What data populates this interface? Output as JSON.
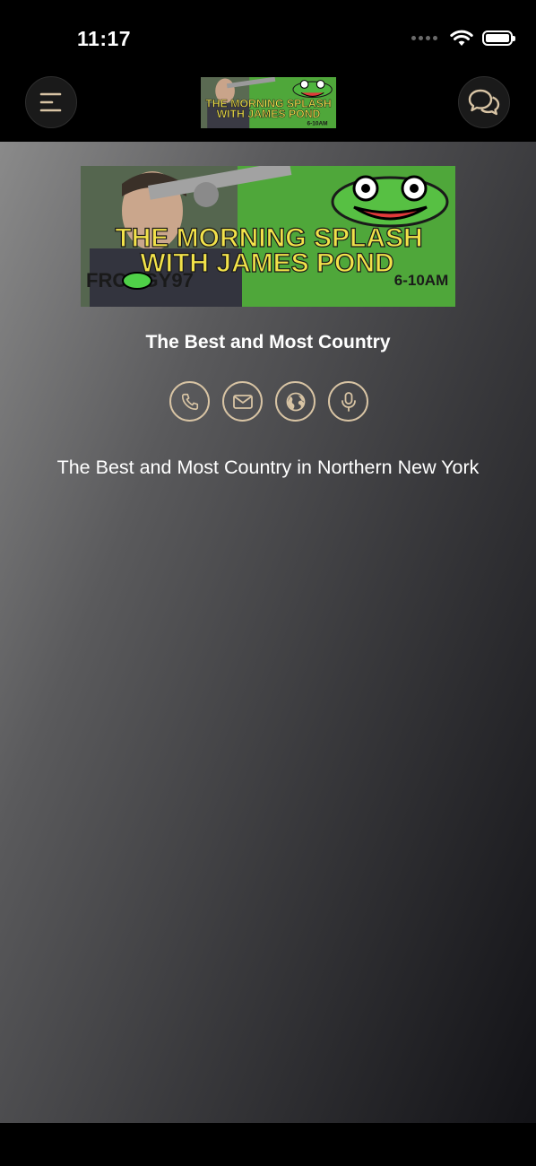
{
  "status_bar": {
    "time": "11:17"
  },
  "nav": {
    "menu_icon": "menu-icon",
    "chat_icon": "chat-bubbles-icon",
    "logo_alt": "The Morning Splash with James Pond 6-10AM"
  },
  "banner": {
    "line1": "THE MORNING SPLASH",
    "line2": "WITH JAMES POND",
    "time_slot": "6-10AM",
    "call_sign": "FROGGY97"
  },
  "station": {
    "title": "The Best and Most Country",
    "description": "The Best and Most Country in Northern New York"
  },
  "actions": [
    {
      "name": "phone",
      "icon": "phone-icon"
    },
    {
      "name": "email",
      "icon": "mail-icon"
    },
    {
      "name": "website",
      "icon": "globe-icon"
    },
    {
      "name": "microphone",
      "icon": "microphone-icon"
    }
  ],
  "colors": {
    "accent": "#d8c4a4",
    "banner_green": "#4fa73a",
    "banner_text": "#f2e24a"
  }
}
